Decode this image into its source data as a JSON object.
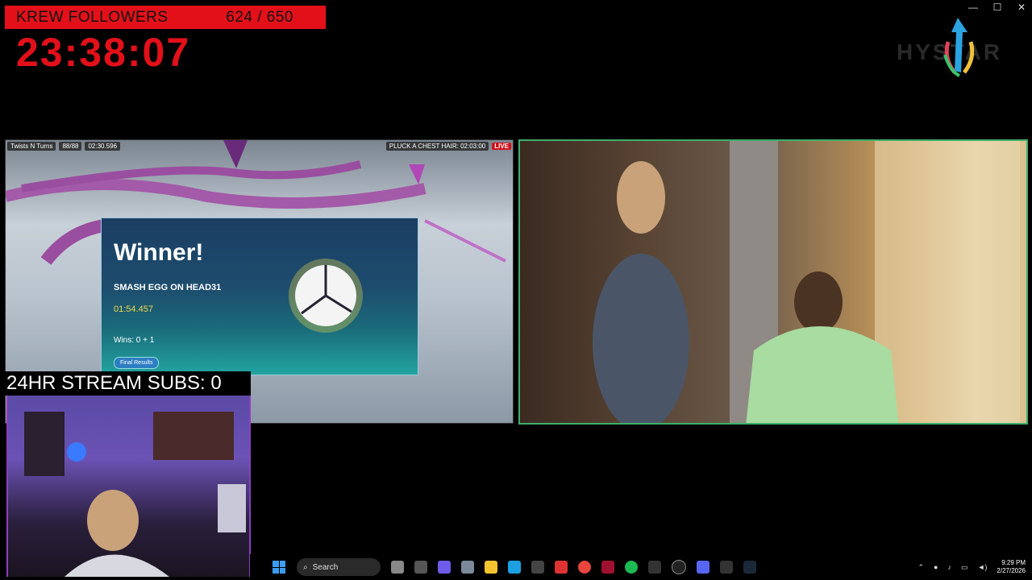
{
  "window": {
    "minimize": "—",
    "maximize": "☐",
    "close": "✕"
  },
  "overlay": {
    "followers_label": "KREW FOLLOWERS",
    "followers_count": "624 / 650",
    "timer": "23:38:07",
    "subs_label": "24HR STREAM SUBS: 0"
  },
  "game": {
    "hud_title": "Twists N Turns",
    "hud_players": "88/88",
    "hud_time": "02:30.596",
    "chest_hair": "PLUCK A CHEST HAIR: 02:03:00",
    "live": "LIVE",
    "winner_title": "Winner!",
    "winner_name": "SMASH EGG ON HEAD31",
    "winner_time": "01:54.457",
    "wins": "Wins: 0 + 1",
    "final_results": "Final Results"
  },
  "taskbar": {
    "search_label": "Search",
    "icons": [
      "widgets-icon",
      "task-view-icon",
      "copilot-icon",
      "settings-icon",
      "file-explorer-icon",
      "edge-icon",
      "store-icon",
      "snip-icon",
      "chrome-icon",
      "app-icon",
      "spotify-icon",
      "gamepad-icon",
      "obs-icon",
      "discord-icon",
      "app2-icon",
      "steam-icon"
    ]
  },
  "tray": {
    "time": "9:29 PM",
    "date": "2/27/2026"
  },
  "colors": {
    "accent_red": "#e3101a",
    "cam_border": "#3fae6b",
    "win_blue": "#3b9cf0"
  }
}
